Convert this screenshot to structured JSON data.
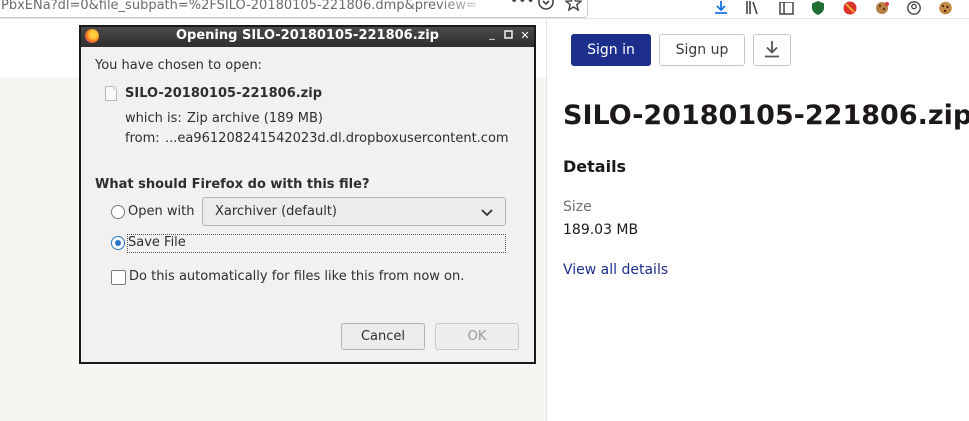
{
  "browser": {
    "url_text": "PbxENa?dl=0&file_subpath=%2FSILO-20180105-221806.dmp&preview=",
    "url_icons": [
      "more-icon",
      "pocket-icon",
      "bookmark-star-icon"
    ],
    "toolbar_icons": [
      "download-arrow-icon",
      "library-icon",
      "sidebar-icon",
      "extension-shield-icon",
      "extension-block-icon",
      "extension-cookie-icon",
      "account-icon",
      "cookie-icon"
    ]
  },
  "page": {
    "sign_in": "Sign in",
    "sign_up": "Sign up",
    "file_title": "SILO-20180105-221806.zip",
    "details_heading": "Details",
    "size_label": "Size",
    "size_value": "189.03 MB",
    "view_all_details": "View all details",
    "colors": {
      "primary": "#1e2e8c",
      "background_left": "#f7f5f2"
    }
  },
  "dialog": {
    "title": "Opening SILO-20180105-221806.zip",
    "chosen_to_open": "You have chosen to open:",
    "file_name": "SILO-20180105-221806.zip",
    "which_is_label": "which is:",
    "which_is_value": "Zip archive (189 MB)",
    "from_label": "from:",
    "from_value": "...ea961208241542023d.dl.dropboxusercontent.com",
    "question": "What should Firefox do with this file?",
    "open_with_label": "Open with",
    "open_with_app": "Xarchiver (default)",
    "save_file_label": "Save File",
    "auto_label": "Do this automatically for files like this from now on.",
    "selected_option": "save_file",
    "auto_checked": false,
    "cancel": "Cancel",
    "ok": "OK",
    "window_buttons": [
      "minimize-icon",
      "maximize-icon",
      "close-icon"
    ]
  }
}
